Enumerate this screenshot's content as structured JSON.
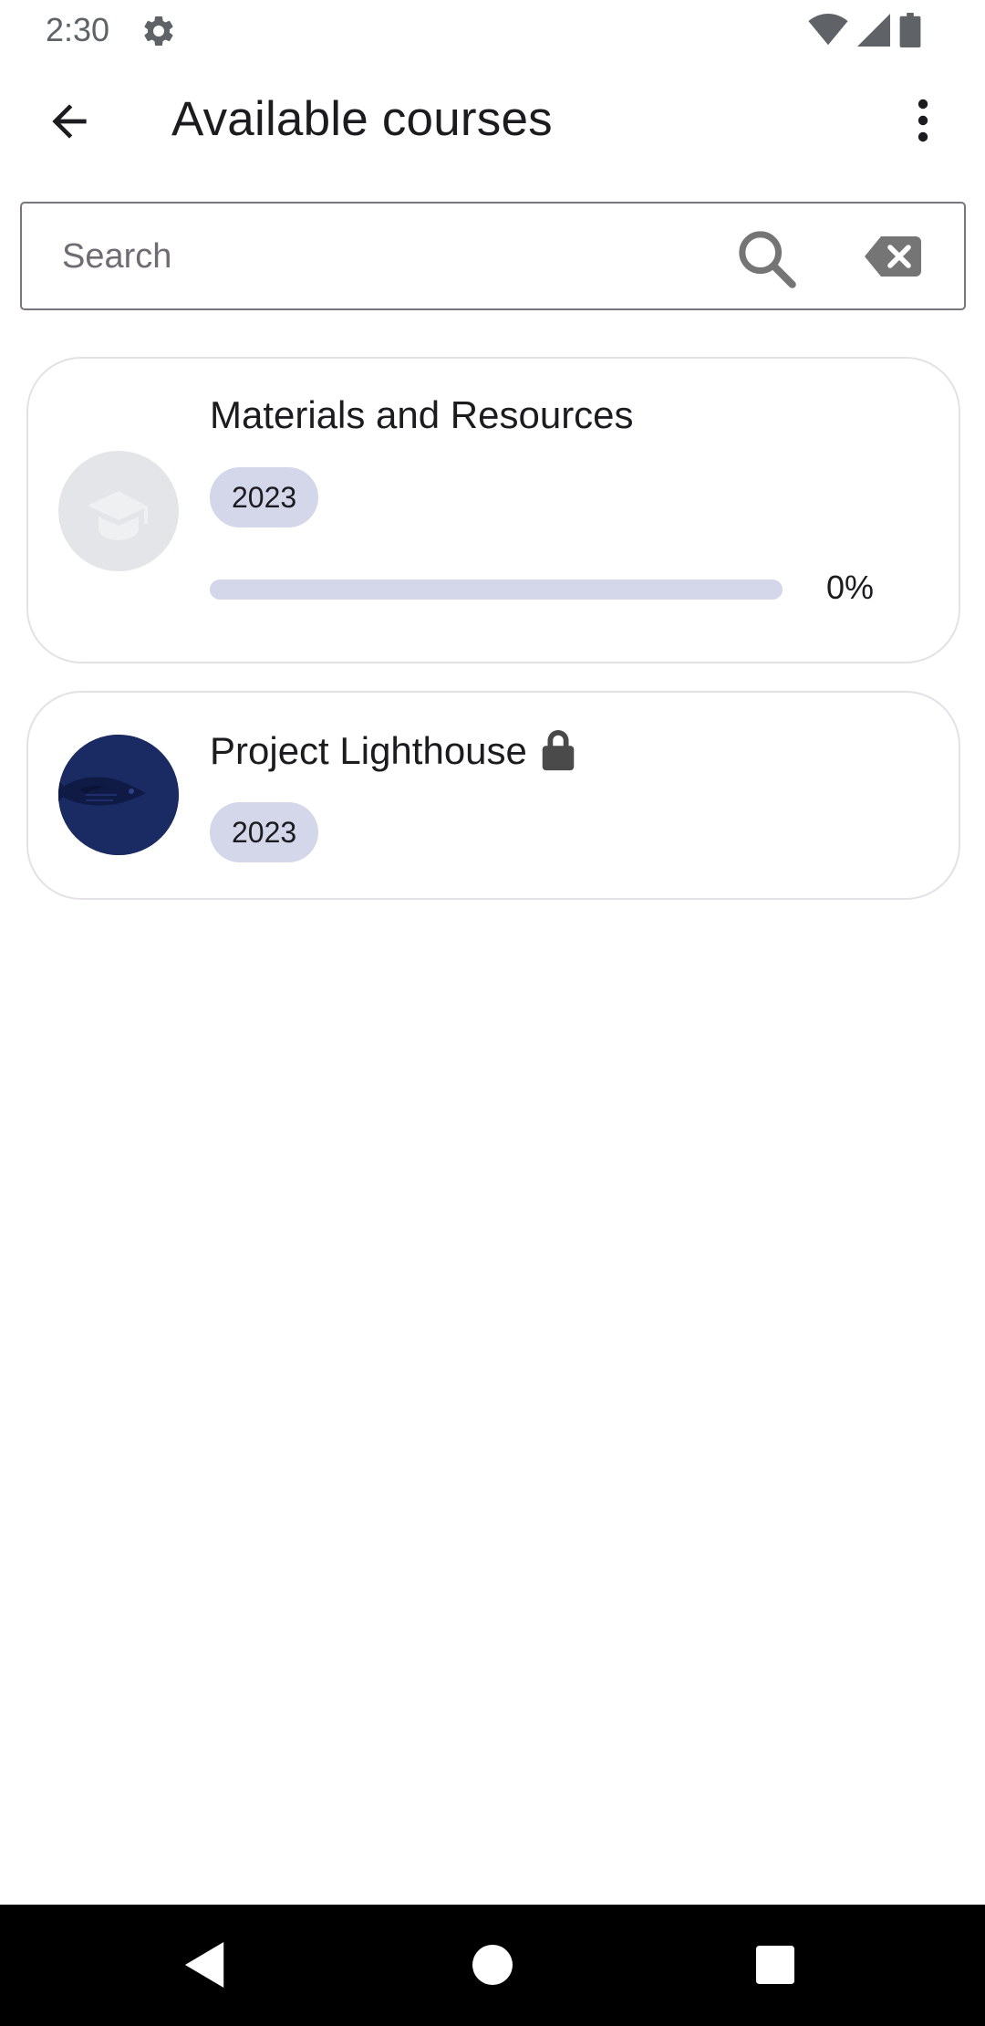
{
  "status_bar": {
    "time": "2:30",
    "icons": [
      "settings-gear-icon",
      "wifi-icon",
      "cellular-signal-icon",
      "battery-icon"
    ]
  },
  "app_bar": {
    "title": "Available courses",
    "back_icon": "arrow-back-icon",
    "menu_icon": "more-vert-icon"
  },
  "search": {
    "placeholder": "Search",
    "value": "",
    "search_icon": "search-icon",
    "clear_icon": "backspace-clear-icon"
  },
  "courses": [
    {
      "title": "Materials and Resources",
      "year": "2023",
      "progress_percent": 0,
      "progress_label": "0%",
      "avatar_icon": "graduation-cap-icon",
      "locked": false
    },
    {
      "title": "Project Lighthouse",
      "year": "2023",
      "avatar_icon": "fish-image",
      "locked": true,
      "lock_icon": "lock-icon"
    }
  ],
  "colors": {
    "chip_bg": "#d4d6ea",
    "progress_track": "#d4d6ea",
    "avatar_dark": "#1a2a63",
    "outline": "#79747e"
  },
  "nav_bar": {
    "buttons": [
      "nav-back-icon",
      "nav-home-icon",
      "nav-recents-icon"
    ]
  }
}
